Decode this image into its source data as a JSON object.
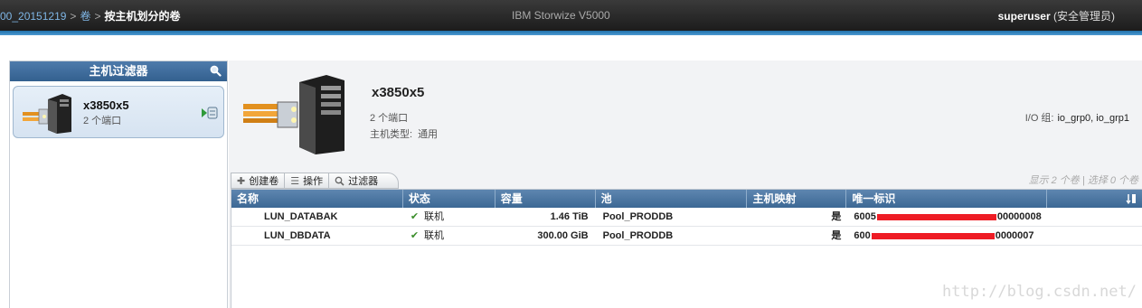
{
  "topbar": {
    "crumb_system": "00_20151219",
    "crumb_sep1": ">",
    "crumb_volumes": "卷",
    "crumb_sep2": ">",
    "crumb_current": "按主机划分的卷",
    "product": "IBM Storwize V5000",
    "user_name": "superuser",
    "user_role": "(安全管理员)"
  },
  "sidebar": {
    "title": "主机过滤器",
    "hosts": [
      {
        "name": "x3850x5",
        "ports": "2 个端口"
      }
    ]
  },
  "host_detail": {
    "name": "x3850x5",
    "ports": "2 个端口",
    "type_label": "主机类型:",
    "type_value": "通用",
    "io_group_label": "I/O 组:",
    "io_group_value": "io_grp0, io_grp1"
  },
  "toolbar": {
    "create_label": "创建卷",
    "actions_label": "操作",
    "filter_label": "过滤器",
    "selection_status": "显示 2 个卷 | 选择 0 个卷"
  },
  "table": {
    "columns": [
      "名称",
      "状态",
      "容量",
      "池",
      "主机映射",
      "唯一标识"
    ],
    "rows": [
      {
        "name": "LUN_DATABAK",
        "status": "联机",
        "capacity": "1.46 TiB",
        "pool": "Pool_PRODDB",
        "mapped": "是",
        "uid_start": "6005",
        "uid_end": "00000008"
      },
      {
        "name": "LUN_DBDATA",
        "status": "联机",
        "capacity": "300.00 GiB",
        "pool": "Pool_PRODDB",
        "mapped": "是",
        "uid_start": "600",
        "uid_end": "0000007"
      }
    ]
  },
  "watermark": "http://blog.csdn.net/",
  "colors": {
    "header_blue": "#3c6894",
    "accent_blue": "#1f6fa8",
    "status_ok": "#3a8d2a",
    "redaction": "#ee1c25"
  },
  "icons": {
    "search": "search-icon",
    "host": "server-icon",
    "mapping": "host-mapping-icon",
    "create": "plus-icon",
    "actions": "list-icon",
    "filter": "search-icon",
    "status": "checkmark-icon",
    "column_menu": "column-sort-icon"
  }
}
